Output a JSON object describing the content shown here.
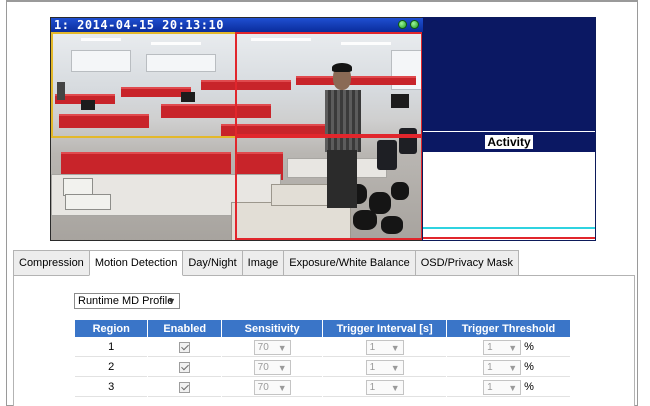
{
  "video": {
    "timestamp": "1:  2014-04-15 20:13:10",
    "regions": [
      {
        "id": "1",
        "color": "#e3b82a"
      },
      {
        "id": "2",
        "color": "#e1262c"
      },
      {
        "id": "3",
        "color": "#e1262c"
      }
    ]
  },
  "activity": {
    "title": "Activity",
    "line_colors": [
      "#2fd3e0",
      "#e1262c"
    ]
  },
  "tabs": [
    {
      "label": "Compression",
      "active": false
    },
    {
      "label": "Motion Detection",
      "active": true
    },
    {
      "label": "Day/Night",
      "active": false
    },
    {
      "label": "Image",
      "active": false
    },
    {
      "label": "Exposure/White Balance",
      "active": false
    },
    {
      "label": "OSD/Privacy Mask",
      "active": false
    }
  ],
  "md": {
    "profile_selected": "Runtime MD Profile",
    "headers": [
      "Region",
      "Enabled",
      "Sensitivity",
      "Trigger Interval [s]",
      "Trigger Threshold"
    ],
    "header_color": "#3a75c8",
    "percent_unit": "%",
    "rows": [
      {
        "region": "1",
        "enabled": true,
        "sensitivity": "70",
        "trigger_interval": "1",
        "trigger_threshold": "1"
      },
      {
        "region": "2",
        "enabled": true,
        "sensitivity": "70",
        "trigger_interval": "1",
        "trigger_threshold": "1"
      },
      {
        "region": "3",
        "enabled": true,
        "sensitivity": "70",
        "trigger_interval": "1",
        "trigger_threshold": "1"
      }
    ]
  }
}
